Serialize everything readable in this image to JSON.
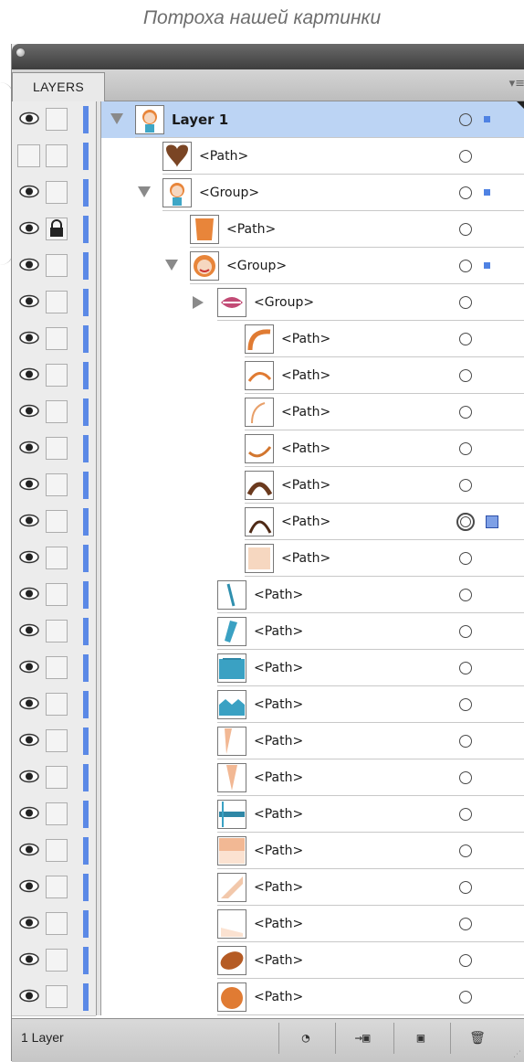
{
  "caption": "Потроха нашей картинки",
  "panel": {
    "tab_label": "LAYERS",
    "menu_icon": "panel-menu-icon",
    "footer_status": "1 Layer",
    "footer_buttons": [
      {
        "name": "locate-object-button",
        "glyph": "◔"
      },
      {
        "name": "make-clipping-mask-button",
        "glyph": "→▣"
      },
      {
        "name": "new-layer-button",
        "glyph": "▣"
      },
      {
        "name": "delete-layer-button",
        "glyph": "🗑"
      }
    ]
  },
  "layers": [
    {
      "label": "Layer 1",
      "visible": true,
      "locked": false,
      "expanded": true,
      "has_children": true,
      "selected": true,
      "thumb": "face",
      "depth": 0,
      "target": "single",
      "sel_mark": "small"
    },
    {
      "label": "<Path>",
      "visible": false,
      "locked": false,
      "has_children": false,
      "thumb": "heart",
      "depth": 1,
      "target": "single"
    },
    {
      "label": "<Group>",
      "visible": true,
      "locked": false,
      "expanded": true,
      "has_children": true,
      "thumb": "face",
      "depth": 1,
      "target": "single",
      "sel_mark": "small"
    },
    {
      "label": "<Path>",
      "visible": true,
      "locked": true,
      "has_children": false,
      "thumb": "neck",
      "depth": 2,
      "target": "single"
    },
    {
      "label": "<Group>",
      "visible": true,
      "locked": false,
      "expanded": true,
      "has_children": true,
      "thumb": "head",
      "depth": 2,
      "target": "single",
      "sel_mark": "small"
    },
    {
      "label": "<Group>",
      "visible": true,
      "locked": false,
      "expanded": false,
      "has_children": true,
      "thumb": "lips",
      "depth": 3,
      "target": "single"
    },
    {
      "label": "<Path>",
      "visible": true,
      "locked": false,
      "has_children": false,
      "thumb": "arc-orange",
      "depth": 4,
      "target": "single"
    },
    {
      "label": "<Path>",
      "visible": true,
      "locked": false,
      "has_children": false,
      "thumb": "arc-orange-thin",
      "depth": 4,
      "target": "single"
    },
    {
      "label": "<Path>",
      "visible": true,
      "locked": false,
      "has_children": false,
      "thumb": "curve-left",
      "depth": 4,
      "target": "single"
    },
    {
      "label": "<Path>",
      "visible": true,
      "locked": false,
      "has_children": false,
      "thumb": "curve-bottom",
      "depth": 4,
      "target": "single"
    },
    {
      "label": "<Path>",
      "visible": true,
      "locked": false,
      "has_children": false,
      "thumb": "arc-brown",
      "depth": 4,
      "target": "single"
    },
    {
      "label": "<Path>",
      "visible": true,
      "locked": false,
      "has_children": false,
      "thumb": "arc-brown-thin",
      "depth": 4,
      "target": "double",
      "sel_mark": "big"
    },
    {
      "label": "<Path>",
      "visible": true,
      "locked": false,
      "has_children": false,
      "thumb": "skin",
      "depth": 4,
      "target": "single"
    },
    {
      "label": "<Path>",
      "visible": true,
      "locked": false,
      "has_children": false,
      "thumb": "tie-thin",
      "depth": 3,
      "target": "single"
    },
    {
      "label": "<Path>",
      "visible": true,
      "locked": false,
      "has_children": false,
      "thumb": "tie",
      "depth": 3,
      "target": "single"
    },
    {
      "label": "<Path>",
      "visible": true,
      "locked": false,
      "has_children": false,
      "thumb": "shirt",
      "depth": 3,
      "target": "single"
    },
    {
      "label": "<Path>",
      "visible": true,
      "locked": false,
      "has_children": false,
      "thumb": "collar",
      "depth": 3,
      "target": "single"
    },
    {
      "label": "<Path>",
      "visible": true,
      "locked": false,
      "has_children": false,
      "thumb": "shade-corner",
      "depth": 3,
      "target": "single"
    },
    {
      "label": "<Path>",
      "visible": true,
      "locked": false,
      "has_children": false,
      "thumb": "shade-strip",
      "depth": 3,
      "target": "single"
    },
    {
      "label": "<Path>",
      "visible": true,
      "locked": false,
      "has_children": false,
      "thumb": "stripe",
      "depth": 3,
      "target": "single"
    },
    {
      "label": "<Path>",
      "visible": true,
      "locked": false,
      "has_children": false,
      "thumb": "shade-top",
      "depth": 3,
      "target": "single"
    },
    {
      "label": "<Path>",
      "visible": true,
      "locked": false,
      "has_children": false,
      "thumb": "shade-diag",
      "depth": 3,
      "target": "single"
    },
    {
      "label": "<Path>",
      "visible": true,
      "locked": false,
      "has_children": false,
      "thumb": "shade-light",
      "depth": 3,
      "target": "single"
    },
    {
      "label": "<Path>",
      "visible": true,
      "locked": false,
      "has_children": false,
      "thumb": "ellipse-brown",
      "depth": 3,
      "target": "single"
    },
    {
      "label": "<Path>",
      "visible": true,
      "locked": false,
      "has_children": false,
      "thumb": "ellipse-orange",
      "depth": 3,
      "target": "single"
    }
  ],
  "colors": {
    "layer_color": "#5b89e6",
    "selection_bg": "#bcd4f4"
  }
}
